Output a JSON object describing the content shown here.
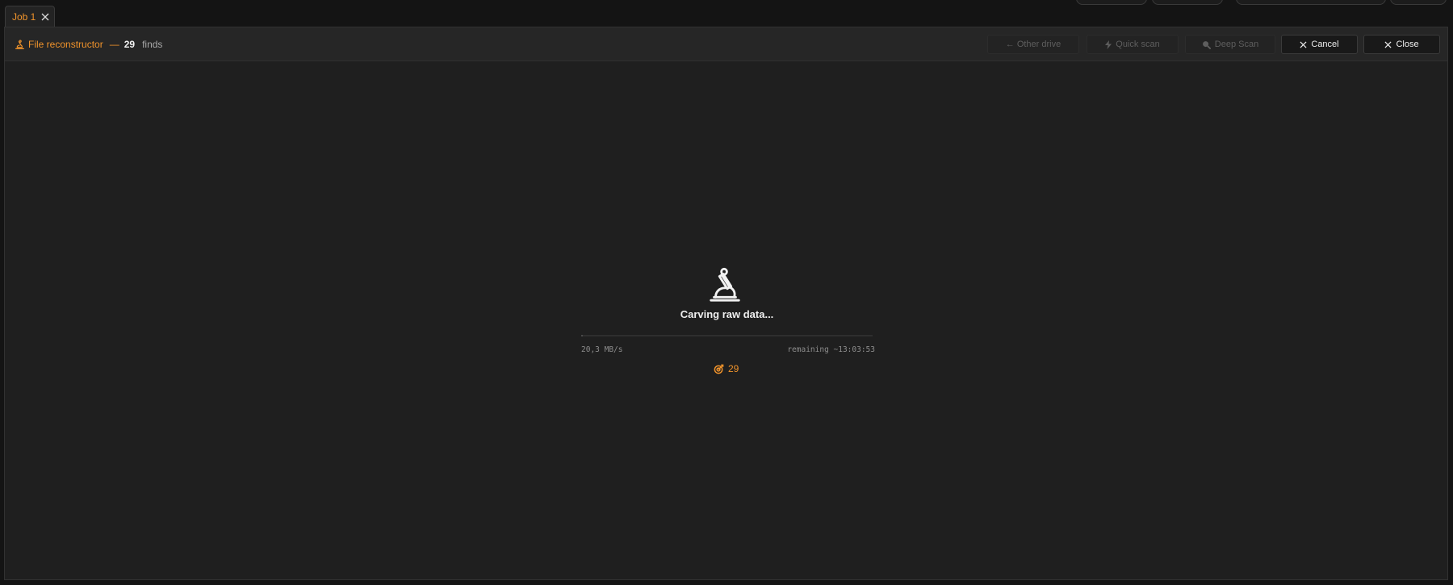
{
  "tab": {
    "label": "Job 1"
  },
  "header": {
    "title": "File reconstructor",
    "separator": "—",
    "count": "29",
    "count_suffix": "finds"
  },
  "buttons": {
    "other_drive": "← Other drive",
    "quick_scan": "Quick scan",
    "deep_scan": "Deep Scan",
    "cancel": "Cancel",
    "close": "Close"
  },
  "scan": {
    "status": "Carving raw data...",
    "progress": 0.005,
    "speed": "20,3 MB/s",
    "remaining": "remaining ~13:03:53",
    "finds": "29"
  },
  "colors": {
    "accent": "#f0932b",
    "background": "#1f1f1f",
    "header_bg": "#262626"
  },
  "icons": {
    "title": "microscope-icon",
    "tab_close": "close-icon",
    "quick_scan": "bolt-icon",
    "deep_scan": "magnifier-icon",
    "cancel": "close-icon",
    "close": "close-icon",
    "status": "microscope-icon",
    "finds": "target-icon"
  }
}
